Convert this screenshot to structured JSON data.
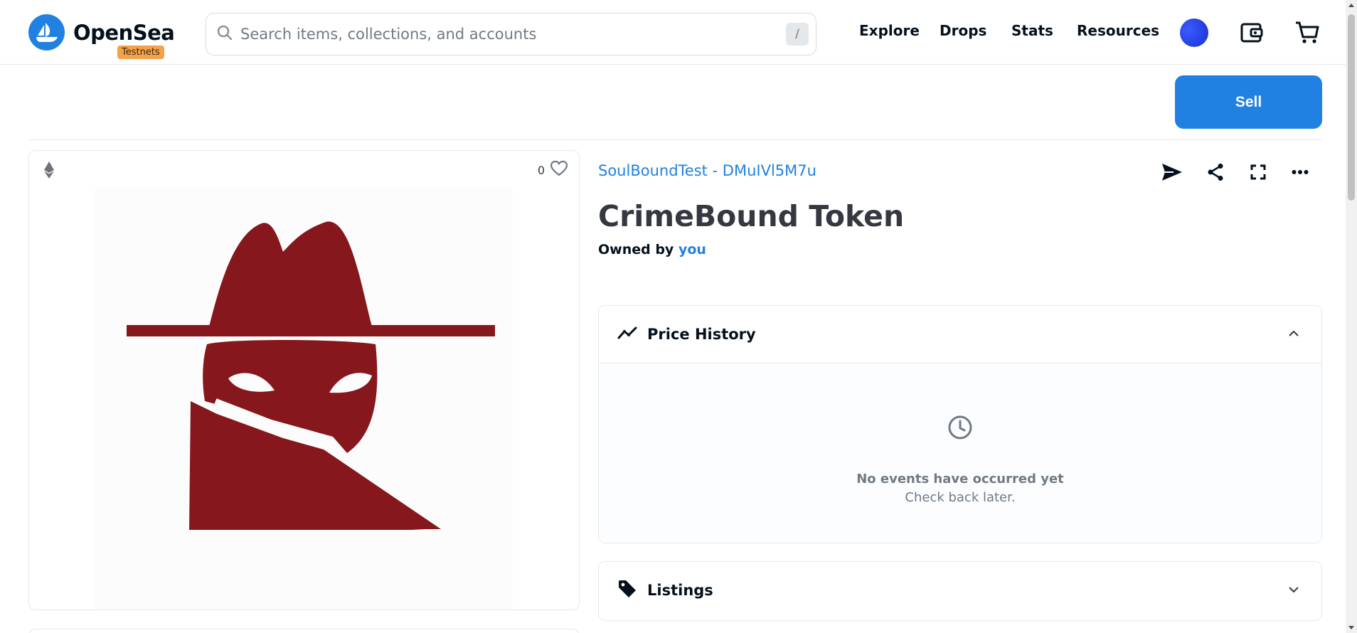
{
  "header": {
    "brand": "OpenSea",
    "badge": "Testnets",
    "search_placeholder": "Search items, collections, and accounts",
    "search_shortcut": "/",
    "nav": [
      "Explore",
      "Drops",
      "Stats",
      "Resources"
    ]
  },
  "toolbar": {
    "sell_label": "Sell"
  },
  "item": {
    "favorites_count": "0",
    "collection": "SoulBoundTest - DMuIVl5M7u",
    "name": "CrimeBound Token",
    "owned_prefix": "Owned by",
    "owner": "you",
    "image_color": "#85171d"
  },
  "price_history": {
    "title": "Price History",
    "empty_title": "No events have occurred yet",
    "empty_sub": "Check back later."
  },
  "listings": {
    "title": "Listings"
  },
  "colors": {
    "accent": "#2081e2",
    "badge": "#f4a14a"
  }
}
